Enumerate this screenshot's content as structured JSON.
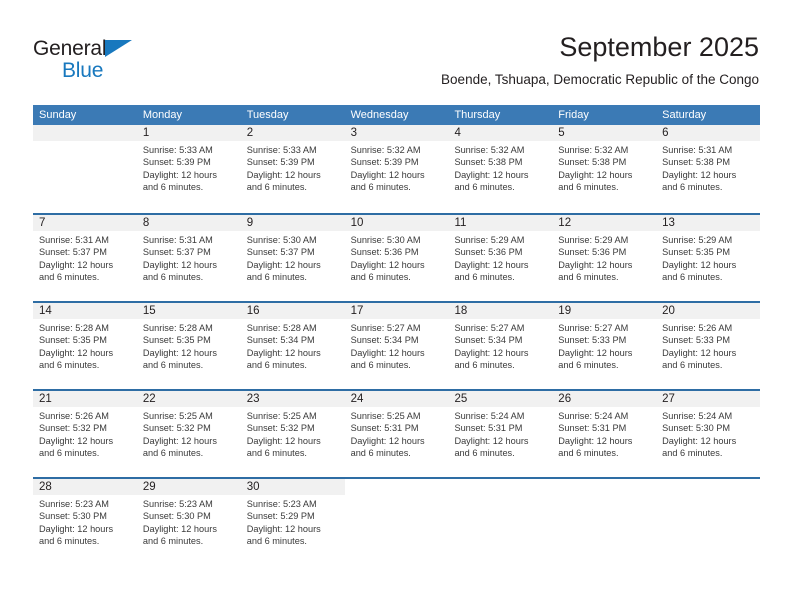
{
  "logo": {
    "word1": "General",
    "word2": "Blue",
    "triangle_color": "#1878be",
    "text_color": "#231f20"
  },
  "header": {
    "month_title": "September 2025",
    "location": "Boende, Tshuapa, Democratic Republic of the Congo"
  },
  "theme": {
    "header_blue": "#3b7ab5",
    "separator_blue": "#2e6da4",
    "band_gray": "#f1f1f1",
    "text_dark": "#231f20",
    "text_body": "#3a3a3a"
  },
  "weekdays": [
    "Sunday",
    "Monday",
    "Tuesday",
    "Wednesday",
    "Thursday",
    "Friday",
    "Saturday"
  ],
  "weeks": [
    {
      "band_span": 7,
      "days": [
        {
          "empty": true
        },
        {
          "day": "1",
          "sunrise": "Sunrise: 5:33 AM",
          "sunset": "Sunset: 5:39 PM",
          "daylight1": "Daylight: 12 hours",
          "daylight2": "and 6 minutes."
        },
        {
          "day": "2",
          "sunrise": "Sunrise: 5:33 AM",
          "sunset": "Sunset: 5:39 PM",
          "daylight1": "Daylight: 12 hours",
          "daylight2": "and 6 minutes."
        },
        {
          "day": "3",
          "sunrise": "Sunrise: 5:32 AM",
          "sunset": "Sunset: 5:39 PM",
          "daylight1": "Daylight: 12 hours",
          "daylight2": "and 6 minutes."
        },
        {
          "day": "4",
          "sunrise": "Sunrise: 5:32 AM",
          "sunset": "Sunset: 5:38 PM",
          "daylight1": "Daylight: 12 hours",
          "daylight2": "and 6 minutes."
        },
        {
          "day": "5",
          "sunrise": "Sunrise: 5:32 AM",
          "sunset": "Sunset: 5:38 PM",
          "daylight1": "Daylight: 12 hours",
          "daylight2": "and 6 minutes."
        },
        {
          "day": "6",
          "sunrise": "Sunrise: 5:31 AM",
          "sunset": "Sunset: 5:38 PM",
          "daylight1": "Daylight: 12 hours",
          "daylight2": "and 6 minutes."
        }
      ]
    },
    {
      "band_span": 7,
      "days": [
        {
          "day": "7",
          "sunrise": "Sunrise: 5:31 AM",
          "sunset": "Sunset: 5:37 PM",
          "daylight1": "Daylight: 12 hours",
          "daylight2": "and 6 minutes."
        },
        {
          "day": "8",
          "sunrise": "Sunrise: 5:31 AM",
          "sunset": "Sunset: 5:37 PM",
          "daylight1": "Daylight: 12 hours",
          "daylight2": "and 6 minutes."
        },
        {
          "day": "9",
          "sunrise": "Sunrise: 5:30 AM",
          "sunset": "Sunset: 5:37 PM",
          "daylight1": "Daylight: 12 hours",
          "daylight2": "and 6 minutes."
        },
        {
          "day": "10",
          "sunrise": "Sunrise: 5:30 AM",
          "sunset": "Sunset: 5:36 PM",
          "daylight1": "Daylight: 12 hours",
          "daylight2": "and 6 minutes."
        },
        {
          "day": "11",
          "sunrise": "Sunrise: 5:29 AM",
          "sunset": "Sunset: 5:36 PM",
          "daylight1": "Daylight: 12 hours",
          "daylight2": "and 6 minutes."
        },
        {
          "day": "12",
          "sunrise": "Sunrise: 5:29 AM",
          "sunset": "Sunset: 5:36 PM",
          "daylight1": "Daylight: 12 hours",
          "daylight2": "and 6 minutes."
        },
        {
          "day": "13",
          "sunrise": "Sunrise: 5:29 AM",
          "sunset": "Sunset: 5:35 PM",
          "daylight1": "Daylight: 12 hours",
          "daylight2": "and 6 minutes."
        }
      ]
    },
    {
      "band_span": 7,
      "days": [
        {
          "day": "14",
          "sunrise": "Sunrise: 5:28 AM",
          "sunset": "Sunset: 5:35 PM",
          "daylight1": "Daylight: 12 hours",
          "daylight2": "and 6 minutes."
        },
        {
          "day": "15",
          "sunrise": "Sunrise: 5:28 AM",
          "sunset": "Sunset: 5:35 PM",
          "daylight1": "Daylight: 12 hours",
          "daylight2": "and 6 minutes."
        },
        {
          "day": "16",
          "sunrise": "Sunrise: 5:28 AM",
          "sunset": "Sunset: 5:34 PM",
          "daylight1": "Daylight: 12 hours",
          "daylight2": "and 6 minutes."
        },
        {
          "day": "17",
          "sunrise": "Sunrise: 5:27 AM",
          "sunset": "Sunset: 5:34 PM",
          "daylight1": "Daylight: 12 hours",
          "daylight2": "and 6 minutes."
        },
        {
          "day": "18",
          "sunrise": "Sunrise: 5:27 AM",
          "sunset": "Sunset: 5:34 PM",
          "daylight1": "Daylight: 12 hours",
          "daylight2": "and 6 minutes."
        },
        {
          "day": "19",
          "sunrise": "Sunrise: 5:27 AM",
          "sunset": "Sunset: 5:33 PM",
          "daylight1": "Daylight: 12 hours",
          "daylight2": "and 6 minutes."
        },
        {
          "day": "20",
          "sunrise": "Sunrise: 5:26 AM",
          "sunset": "Sunset: 5:33 PM",
          "daylight1": "Daylight: 12 hours",
          "daylight2": "and 6 minutes."
        }
      ]
    },
    {
      "band_span": 7,
      "days": [
        {
          "day": "21",
          "sunrise": "Sunrise: 5:26 AM",
          "sunset": "Sunset: 5:32 PM",
          "daylight1": "Daylight: 12 hours",
          "daylight2": "and 6 minutes."
        },
        {
          "day": "22",
          "sunrise": "Sunrise: 5:25 AM",
          "sunset": "Sunset: 5:32 PM",
          "daylight1": "Daylight: 12 hours",
          "daylight2": "and 6 minutes."
        },
        {
          "day": "23",
          "sunrise": "Sunrise: 5:25 AM",
          "sunset": "Sunset: 5:32 PM",
          "daylight1": "Daylight: 12 hours",
          "daylight2": "and 6 minutes."
        },
        {
          "day": "24",
          "sunrise": "Sunrise: 5:25 AM",
          "sunset": "Sunset: 5:31 PM",
          "daylight1": "Daylight: 12 hours",
          "daylight2": "and 6 minutes."
        },
        {
          "day": "25",
          "sunrise": "Sunrise: 5:24 AM",
          "sunset": "Sunset: 5:31 PM",
          "daylight1": "Daylight: 12 hours",
          "daylight2": "and 6 minutes."
        },
        {
          "day": "26",
          "sunrise": "Sunrise: 5:24 AM",
          "sunset": "Sunset: 5:31 PM",
          "daylight1": "Daylight: 12 hours",
          "daylight2": "and 6 minutes."
        },
        {
          "day": "27",
          "sunrise": "Sunrise: 5:24 AM",
          "sunset": "Sunset: 5:30 PM",
          "daylight1": "Daylight: 12 hours",
          "daylight2": "and 6 minutes."
        }
      ]
    },
    {
      "band_span": 3,
      "days": [
        {
          "day": "28",
          "sunrise": "Sunrise: 5:23 AM",
          "sunset": "Sunset: 5:30 PM",
          "daylight1": "Daylight: 12 hours",
          "daylight2": "and 6 minutes."
        },
        {
          "day": "29",
          "sunrise": "Sunrise: 5:23 AM",
          "sunset": "Sunset: 5:30 PM",
          "daylight1": "Daylight: 12 hours",
          "daylight2": "and 6 minutes."
        },
        {
          "day": "30",
          "sunrise": "Sunrise: 5:23 AM",
          "sunset": "Sunset: 5:29 PM",
          "daylight1": "Daylight: 12 hours",
          "daylight2": "and 6 minutes."
        },
        {
          "empty": true
        },
        {
          "empty": true
        },
        {
          "empty": true
        },
        {
          "empty": true
        }
      ]
    }
  ]
}
